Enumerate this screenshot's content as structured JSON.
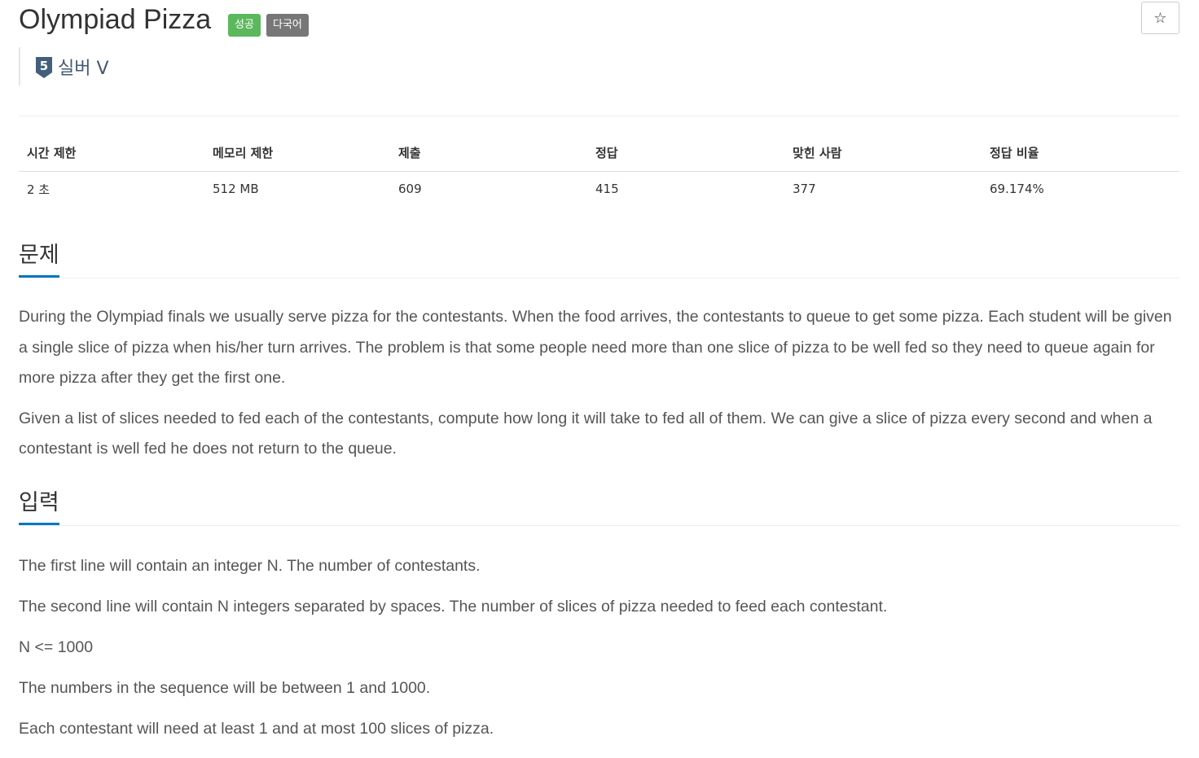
{
  "problem": {
    "title": "Olympiad Pizza",
    "badges": {
      "success": "성공",
      "multilang": "다국어"
    },
    "star_icon": "☆",
    "tier": {
      "number": "5",
      "label": "실버 V",
      "color": "#455872"
    }
  },
  "info_table": {
    "headers": [
      "시간 제한",
      "메모리 제한",
      "제출",
      "정답",
      "맞힌 사람",
      "정답 비율"
    ],
    "values": [
      "2 초",
      "512 MB",
      "609",
      "415",
      "377",
      "69.174%"
    ]
  },
  "sections": {
    "problem": {
      "title": "문제",
      "paragraphs": [
        "During the Olympiad finals we usually serve pizza for the contestants. When the food arrives, the contestants to queue to get some pizza. Each student will be given a single slice of pizza when his/her turn arrives. The problem is that some people need more than one slice of pizza to be well fed so they need to queue again for more pizza after they get the first one.",
        "Given a list of slices needed to fed each of the contestants, compute how long it will take to fed all of them. We can give a slice of pizza every second and when a contestant is well fed he does not return to the queue."
      ]
    },
    "input": {
      "title": "입력",
      "paragraphs": [
        "The first line will contain an integer N. The number of contestants.",
        "The second line will contain N integers separated by spaces. The number of slices of pizza needed to feed each contestant.",
        "N <= 1000",
        "The numbers in the sequence will be between 1 and 1000.",
        "Each contestant will need at least 1 and at most 100 slices of pizza."
      ]
    }
  },
  "colors": {
    "success_badge": "#5cb85c",
    "multilang_badge": "#777777",
    "section_underline": "#0076c0"
  }
}
